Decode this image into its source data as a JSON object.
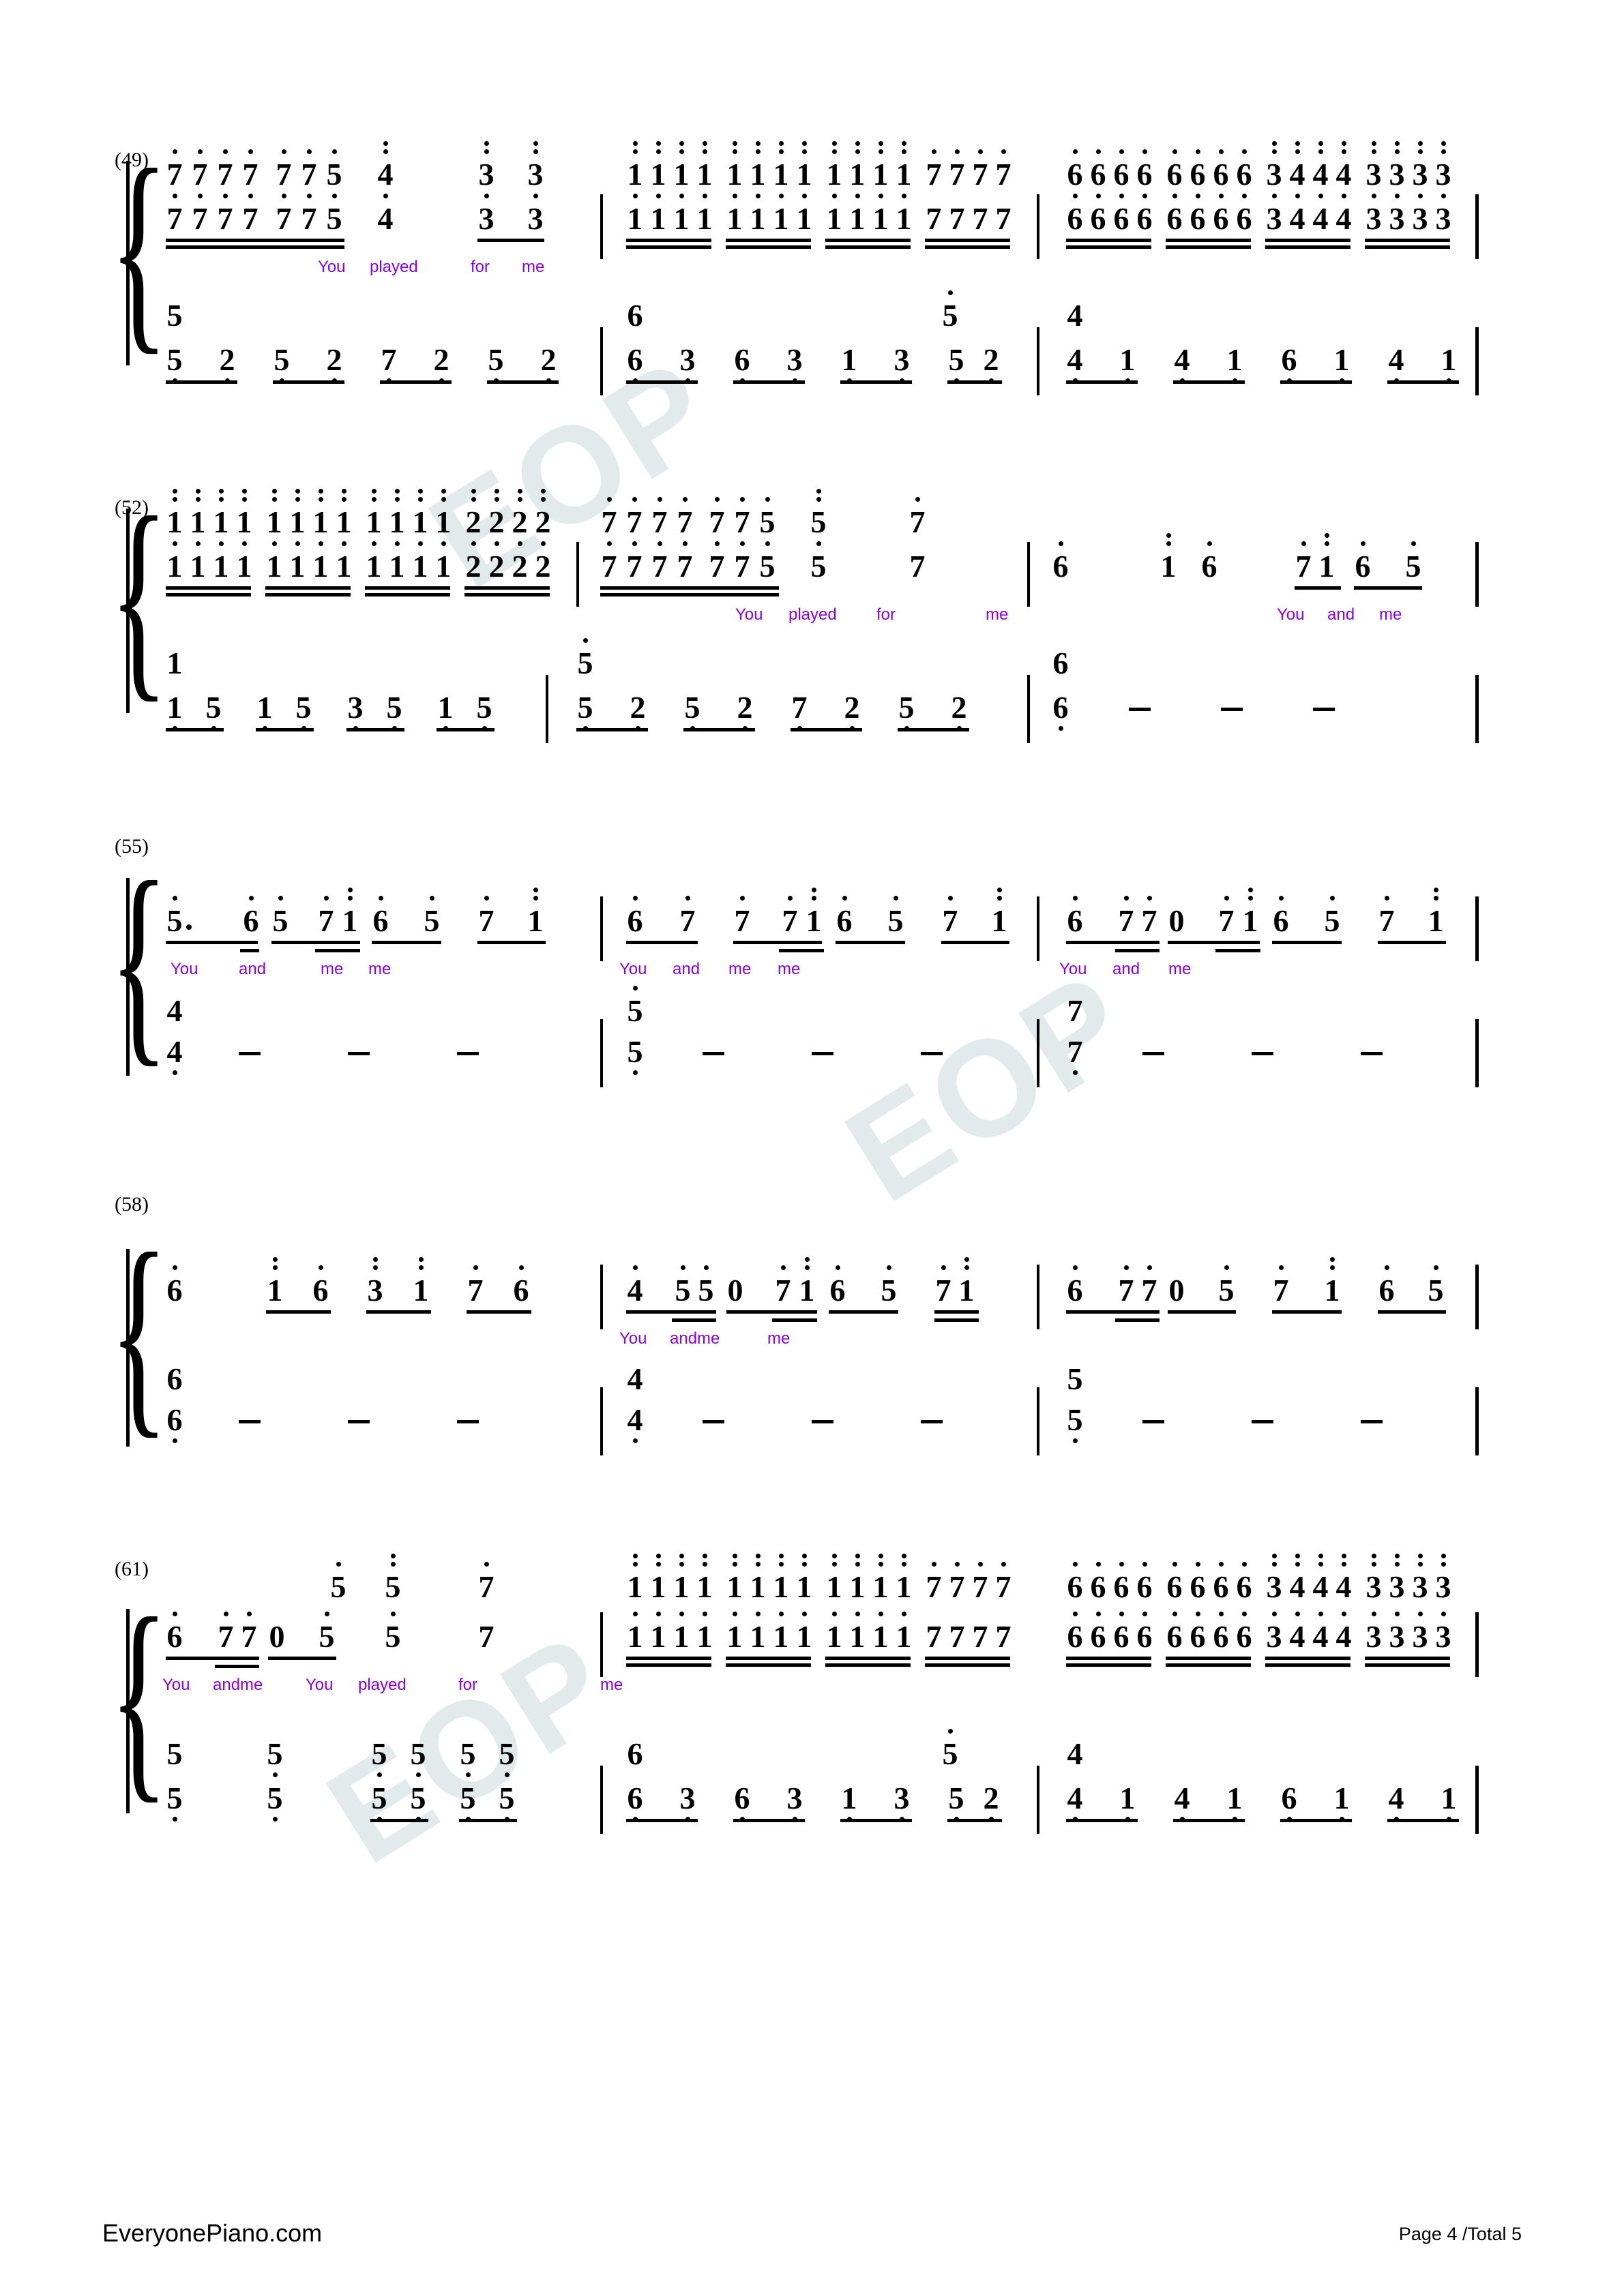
{
  "document": {
    "type": "numbered-musical-notation",
    "title_hidden": true,
    "footer": {
      "site": "EveryonePiano.com",
      "page_label": "Page 4 /Total 5"
    },
    "watermark_text": "EOP",
    "lyric_color": "#8a00e6",
    "note_color": "#000000"
  },
  "systems": [
    {
      "measure_label": "(49)",
      "treble_upper": "7 7 7 7 7 7 5  4   3  3 | 1 1 1 1 1 1 1 1 1 1 1 1 7 7 7 7 | 6 6 6 6 6 6 6 6 3 4 4 4 3 3 3 3",
      "treble_lower": "7 7 7 7 7 7 5  4   3  3 | 1 1 1 1 1 1 1 1 1 1 1 1 7 7 7 7 | 6 6 6 6 6 6 6 6 3 4 4 4 3 3 3 3",
      "bass_upper": "5 | 6 | 5  4",
      "bass_lower": "5 2 5 2 7 2 5 2 | 6 3 6 3 1 3 5 2 | 4 1 4 1 6 1 4 1",
      "lyrics": [
        "You",
        "played",
        "for",
        "me"
      ]
    },
    {
      "measure_label": "(52)",
      "treble_upper": "1 1 1 1 1 1 1 1 1 1 1 1 2 2 2 2 | 7 7 7 7 7 7 5  5   7 | 6   1 6   7 1 6 5",
      "treble_lower": "1 1 1 1 1 1 1 1 1 1 1 1 2 2 2 2 | 7 7 7 7 7 7 5  5   7 | 6   1 6   7 1 6 5",
      "bass_upper": "1 | 5 | 6",
      "bass_lower": "1 5 1 5 3 5 1 5 | 5 2 5 2 7 2 5 2 | 6 - - -",
      "lyrics": [
        "You",
        "played",
        "for",
        "me",
        "You",
        "and",
        "me"
      ]
    },
    {
      "measure_label": "(55)",
      "treble": "5. 6 5 7 1 6 5 7 1 | 6 7 7 7 1 6 5 7 1 | 6 7 7 0 7 1 6 5 7 1",
      "bass_upper": "4 | 5 | 7",
      "bass_lower": "4 - - - | 5 - - - | 7 - - -",
      "lyrics": [
        "You",
        "and",
        "me",
        "me",
        "You",
        "and",
        "me",
        "me",
        "You",
        "and",
        "me"
      ]
    },
    {
      "measure_label": "(58)",
      "treble": "6  1 6 3 1 7 6 | 4 5 5 0 7 1 6 5 7 1 | 6 7 7 0 5 7 1 6 5",
      "bass_upper": "6 | 4 | 5",
      "bass_lower": "6 - - - | 4 - - - | 5 - - -",
      "lyrics": [
        "You",
        "andme",
        "me"
      ]
    },
    {
      "measure_label": "(61)",
      "treble_upper_floats": "5 5 7",
      "treble": "6 7 7 0 5 5 7 | 1 1 1 1 1 1 1 1 1 1 1 1 7 7 7 7 | 6 6 6 6 6 6 6 6 3 4 4 4 3 3 3 3",
      "treble_lower": "1 1 1 1 1 1 1 1 1 1 1 1 7 7 7 7 | 6 6 6 6 6 6 6 6 3 4 4 4 3 3 3 3",
      "bass_upper": "5 5 5 5 5 5 | 6 | 5 4",
      "bass_lower": "5 5 5 5 5 5 | 6 3 6 3 1 3 5 2 | 4 1 4 1 6 1 4 1",
      "lyrics": [
        "You",
        "andme",
        "You",
        "played",
        "for",
        "me"
      ]
    }
  ],
  "lyrics_all": [
    "You played for me",
    "You played for me",
    "You and me",
    "You and me me",
    "You and me me",
    "You and me",
    "You andme me",
    "You andme",
    "You played for me"
  ]
}
